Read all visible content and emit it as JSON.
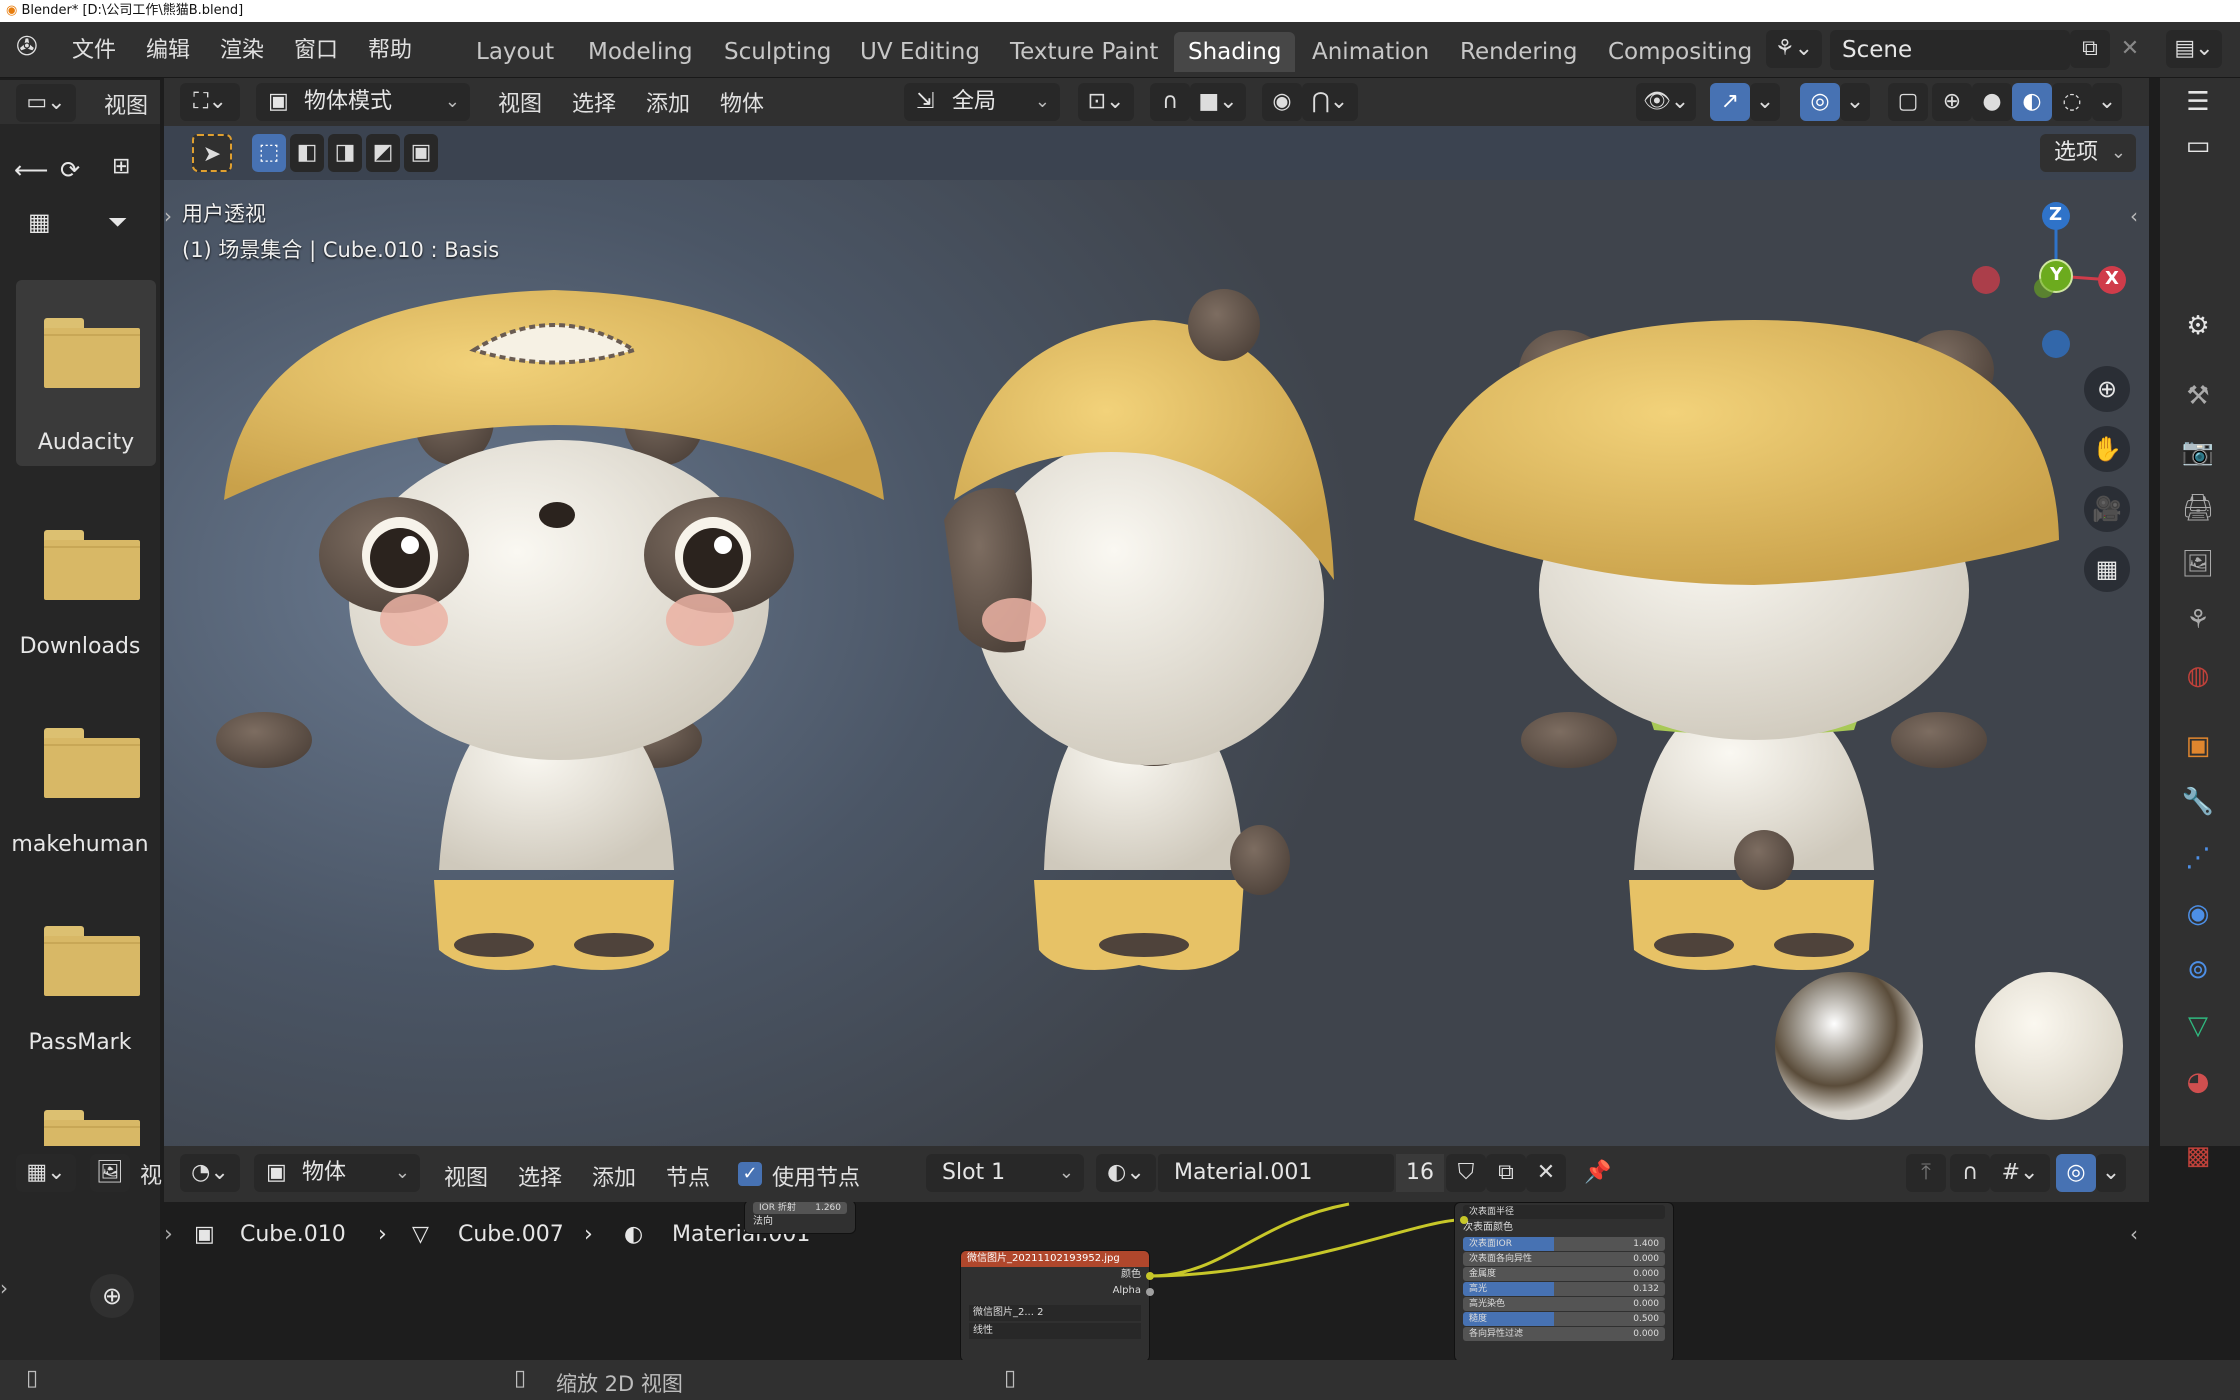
{
  "window": {
    "title": "Blender* [D:\\公司工作\\熊猫B.blend]"
  },
  "menu": [
    "文件",
    "编辑",
    "渲染",
    "窗口",
    "帮助"
  ],
  "workspaces": [
    {
      "label": "Layout",
      "active": false
    },
    {
      "label": "Modeling",
      "active": false
    },
    {
      "label": "Sculpting",
      "active": false
    },
    {
      "label": "UV Editing",
      "active": false
    },
    {
      "label": "Texture Paint",
      "active": false
    },
    {
      "label": "Shading",
      "active": true
    },
    {
      "label": "Animation",
      "active": false
    },
    {
      "label": "Rendering",
      "active": false
    },
    {
      "label": "Compositing",
      "active": false
    }
  ],
  "scene": "Scene",
  "file_browser": {
    "view_label": "视图",
    "folders": [
      "Audacity",
      "Downloads",
      "makehuman",
      "PassMark"
    ]
  },
  "viewport_header": {
    "mode": "物体模式",
    "menus": [
      "视图",
      "选择",
      "添加",
      "物体"
    ],
    "orientation": "全局",
    "options": "选项"
  },
  "viewport": {
    "view_name": "用户透视",
    "object_info": "(1) 场景集合 | Cube.010 : Basis",
    "gizmo": {
      "x": "X",
      "y": "Y",
      "z": "Z"
    }
  },
  "node_header": {
    "object_type": "物体",
    "menus": [
      "视图",
      "选择",
      "添加",
      "节点"
    ],
    "use_nodes": "使用节点",
    "slot": "Slot 1",
    "material": "Material.001",
    "users": "16",
    "side_view": "视"
  },
  "breadcrumb": [
    "Cube.010",
    "Cube.007",
    "Material.001"
  ],
  "nodes": {
    "image_node_title": "微信图片_20211102193952.jpg",
    "image_outputs": [
      "颜色",
      "Alpha"
    ],
    "image_name": "微信图片_2...",
    "image_users": "2",
    "interpolation": "线性",
    "fragment_rows": [
      {
        "label": "IOR 折射",
        "value": "1.260"
      },
      {
        "label": "法向",
        "value": ""
      }
    ],
    "bsdf_dropdown": "次表面半径",
    "bsdf_color": "次表面颜色",
    "bsdf_rows": [
      {
        "label": "次表面IOR",
        "value": "1.400",
        "highlight": true
      },
      {
        "label": "次表面各向异性",
        "value": "0.000",
        "highlight": false
      },
      {
        "label": "金属度",
        "value": "0.000",
        "highlight": false
      },
      {
        "label": "高光",
        "value": "0.132",
        "highlight": true
      },
      {
        "label": "高光染色",
        "value": "0.000",
        "highlight": false
      },
      {
        "label": "糙度",
        "value": "0.500",
        "highlight": true
      },
      {
        "label": "各向异性过滤",
        "value": "0.000",
        "highlight": false
      }
    ]
  },
  "status_bar": {
    "hint": "缩放 2D 视图"
  },
  "colors": {
    "accent": "#4772b3",
    "panda_hat": "#e7c266",
    "panda_body": "#efebe2",
    "panda_dark": "#6a5c52",
    "scarf": "#a8c956"
  }
}
